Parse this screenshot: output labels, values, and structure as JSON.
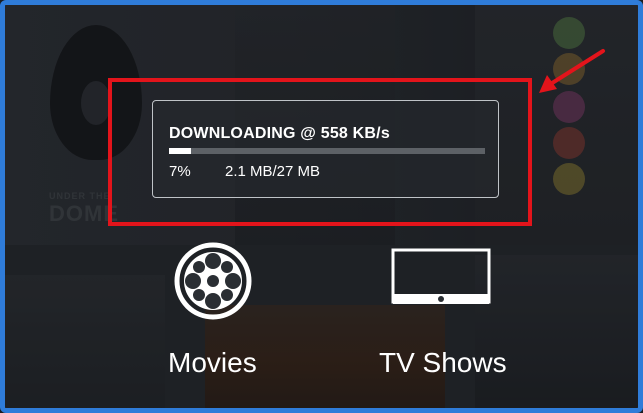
{
  "download": {
    "title": "DOWNLOADING @ 558 KB/s",
    "percent_label": "7%",
    "progress_fraction": 0.07,
    "size_label": "2.1 MB/27 MB"
  },
  "categories": [
    {
      "label": "Movies",
      "icon": "film-reel-icon"
    },
    {
      "label": "TV Shows",
      "icon": "tv-icon"
    }
  ],
  "background": {
    "poster_small_text": "UNDER THE",
    "poster_title": "DOME"
  },
  "colors": {
    "frame_border": "#2f7cd9",
    "highlight": "#e3141b",
    "progress_fill": "#ffffff",
    "progress_track": "#5d6166"
  }
}
